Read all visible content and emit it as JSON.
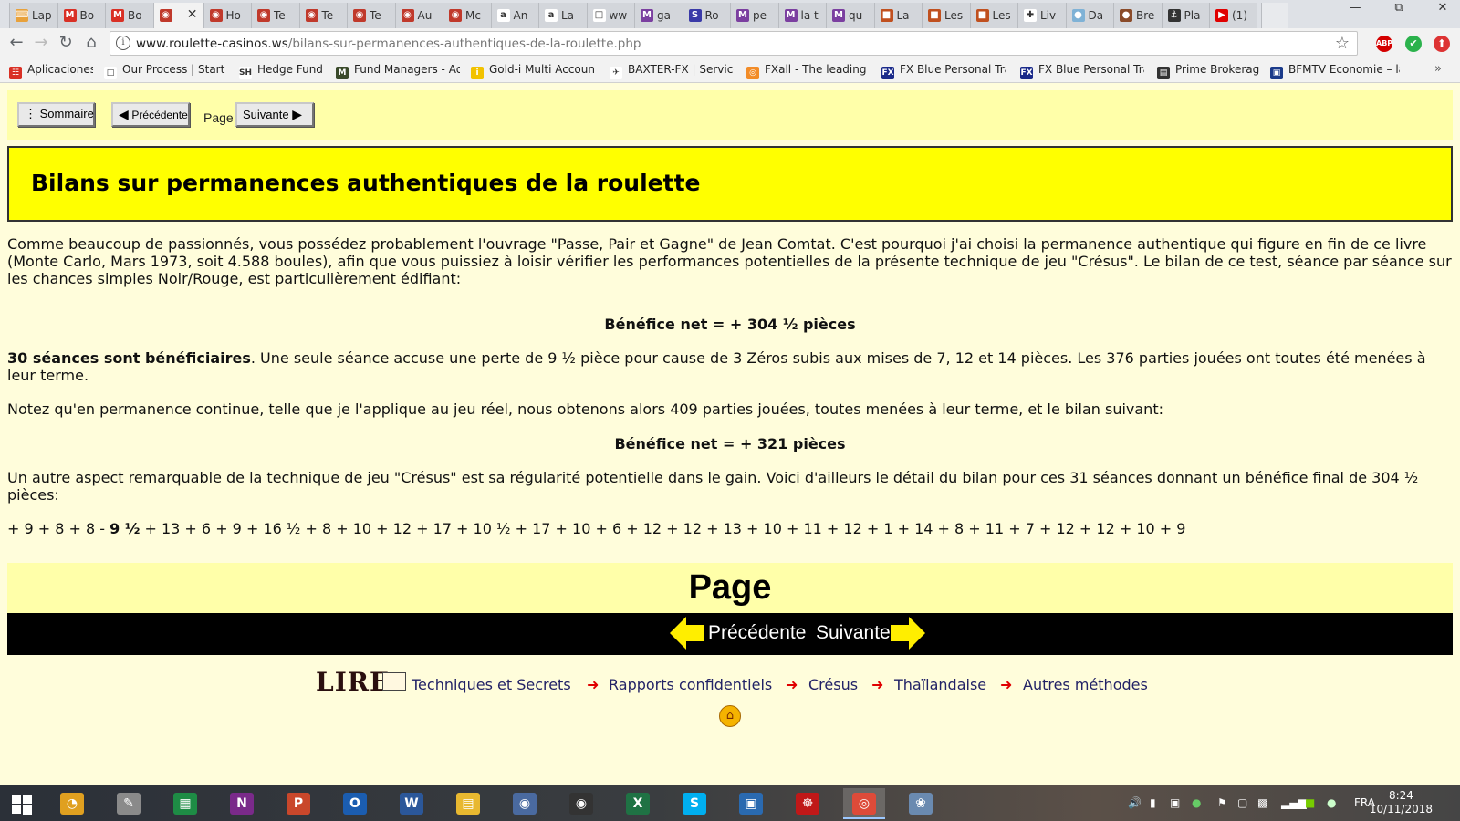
{
  "browser": {
    "tabs": [
      {
        "label": "Lap",
        "color": "#e8a13a",
        "glyph": "⌨"
      },
      {
        "label": "Bo",
        "color": "#d93025",
        "glyph": "M"
      },
      {
        "label": "Bo",
        "color": "#d93025",
        "glyph": "M"
      },
      {
        "label": "",
        "color": "#c0392b",
        "glyph": "◉",
        "active": true
      },
      {
        "label": "Ho",
        "color": "#c0392b",
        "glyph": "◉"
      },
      {
        "label": "Te",
        "color": "#c0392b",
        "glyph": "◉"
      },
      {
        "label": "Te",
        "color": "#c0392b",
        "glyph": "◉"
      },
      {
        "label": "Te",
        "color": "#c0392b",
        "glyph": "◉"
      },
      {
        "label": "Au",
        "color": "#c0392b",
        "glyph": "◉"
      },
      {
        "label": "Mc",
        "color": "#c0392b",
        "glyph": "◉"
      },
      {
        "label": "An",
        "color": "#ffffff",
        "glyph": "a"
      },
      {
        "label": "La",
        "color": "#ffffff",
        "glyph": "a"
      },
      {
        "label": "ww",
        "color": "#ffffff",
        "glyph": "□"
      },
      {
        "label": "ga",
        "color": "#7b3fa0",
        "glyph": "M"
      },
      {
        "label": "Ro",
        "color": "#3a3aa8",
        "glyph": "S"
      },
      {
        "label": "pe",
        "color": "#7b3fa0",
        "glyph": "M"
      },
      {
        "label": "la t",
        "color": "#7b3fa0",
        "glyph": "M"
      },
      {
        "label": "qu",
        "color": "#7b3fa0",
        "glyph": "M"
      },
      {
        "label": "La",
        "color": "#c0501f",
        "glyph": "■"
      },
      {
        "label": "Les",
        "color": "#c0501f",
        "glyph": "■"
      },
      {
        "label": "Les",
        "color": "#c0501f",
        "glyph": "■"
      },
      {
        "label": "Liv",
        "color": "#ffffff",
        "glyph": "✚"
      },
      {
        "label": "Da",
        "color": "#7fb2d6",
        "glyph": "●"
      },
      {
        "label": "Bre",
        "color": "#8a4b2a",
        "glyph": "●"
      },
      {
        "label": "Pla",
        "color": "#333333",
        "glyph": "⚓"
      },
      {
        "label": "(1)",
        "color": "#e00000",
        "glyph": "▶"
      }
    ],
    "url_domain": "www.roulette-casinos.ws",
    "url_path": "/bilans-sur-permanences-authentiques-de-la-roulette.php",
    "extensions": [
      "ABP",
      "✔",
      "⬆"
    ]
  },
  "bookmarks": [
    {
      "label": "Aplicaciones",
      "icon": "☷",
      "color": "#d93025"
    },
    {
      "label": "Our Process | Start a",
      "icon": "□",
      "color": "#ffffff"
    },
    {
      "label": "Hedge Funds",
      "icon": "SH",
      "color": "#ffffff"
    },
    {
      "label": "Fund Managers - Adv",
      "icon": "M",
      "color": "#3a4a2a"
    },
    {
      "label": "Gold-i Multi Account",
      "icon": "i",
      "color": "#f2c200"
    },
    {
      "label": "BAXTER-FX | Services",
      "icon": "✈",
      "color": "#ffffff"
    },
    {
      "label": "FXall - The leading in",
      "icon": "◎",
      "color": "#f28c28"
    },
    {
      "label": "FX Blue Personal Trac",
      "icon": "FX",
      "color": "#1a2a8a"
    },
    {
      "label": "FX Blue Personal Trac",
      "icon": "FX",
      "color": "#1a2a8a"
    },
    {
      "label": "Prime Brokerage",
      "icon": "▤",
      "color": "#333333"
    },
    {
      "label": "BFMTV Economie – la",
      "icon": "▣",
      "color": "#1a3a8a"
    }
  ],
  "page": {
    "nav": {
      "sommaire": "Sommaire",
      "precedente": "Précédente",
      "page_label": "Page",
      "suivante": "Suivante"
    },
    "title": "Bilans sur permanences authentiques de la roulette",
    "intro": "Comme beaucoup de passionnés, vous possédez probablement l'ouvrage \"Passe, Pair et Gagne\" de Jean Comtat. C'est pourquoi j'ai choisi la permanence authentique qui figure en fin de ce livre (Monte Carlo, Mars 1973, soit 4.588 boules), afin que vous puissiez à loisir vérifier les performances potentielles de la présente technique de jeu \"Crésus\". Le bilan de ce test, séance par séance sur les chances simples Noir/Rouge, est particulièrement édifiant:",
    "benefit1": "Bénéfice net = + 304 ½ pièces",
    "seances_bold": "30 séances sont bénéficiaires",
    "seances_rest": ". Une seule séance accuse une perte de 9 ½ pièce pour cause de 3 Zéros subis aux mises de 7, 12 et 14 pièces. Les 376 parties jouées ont toutes été menées à leur terme.",
    "continuous": "Notez qu'en permanence continue, telle que je l'applique au jeu réel, nous obtenons alors 409 parties jouées, toutes menées à leur terme, et le bilan suivant:",
    "benefit2": "Bénéfice net = + 321 pièces",
    "regularity": "Un autre aspect remarquable de la technique de jeu \"Crésus\" est sa régularité potentielle dans le gain. Voici d'ailleurs le détail du bilan pour ces 31 séances donnant un bénéfice final de 304 ½ pièces:",
    "series_a": "+ 9 + 8 + 8 - ",
    "series_bold": "9 ½",
    "series_b": " + 13 + 6 + 9 + 16 ½ + 8 + 10 + 12 + 17 + 10 ½ + 17 + 10 + 6 + 12 + 12 + 13 + 10 + 11 + 12 + 1 + 14 + 8 + 11 + 7 + 12 + 12 + 10 + 9",
    "band_title": "Page",
    "bottom_prev": "Précédente",
    "bottom_next": "Suivante",
    "lire": "LIRE",
    "footer_links": [
      "Techniques et Secrets",
      "Rapports confidentiels",
      "Crésus",
      "Thaïlandaise",
      "Autres méthodes"
    ]
  },
  "taskbar": {
    "apps": [
      {
        "name": "chrome-canary",
        "color": "#e0a020",
        "glyph": "◔"
      },
      {
        "name": "notepad",
        "color": "#8a8a8a",
        "glyph": "✎"
      },
      {
        "name": "project",
        "color": "#1e8c45",
        "glyph": "▦"
      },
      {
        "name": "onenote",
        "color": "#7a2a8a",
        "glyph": "N"
      },
      {
        "name": "powerpoint",
        "color": "#c9472b",
        "glyph": "P"
      },
      {
        "name": "outlook",
        "color": "#1b5db0",
        "glyph": "O"
      },
      {
        "name": "word",
        "color": "#2b579a",
        "glyph": "W"
      },
      {
        "name": "explorer",
        "color": "#e8b830",
        "glyph": "▤"
      },
      {
        "name": "owl-app",
        "color": "#4a6aa0",
        "glyph": "◉"
      },
      {
        "name": "owl-dark",
        "color": "#333333",
        "glyph": "◉"
      },
      {
        "name": "excel",
        "color": "#1f7244",
        "glyph": "X"
      },
      {
        "name": "skype",
        "color": "#00aff0",
        "glyph": "S"
      },
      {
        "name": "network",
        "color": "#2a6ab0",
        "glyph": "▣"
      },
      {
        "name": "acrobat",
        "color": "#c01818",
        "glyph": "☸"
      },
      {
        "name": "chrome",
        "color": "#dd4b39",
        "glyph": "◎",
        "active": true
      },
      {
        "name": "paint",
        "color": "#6a8ab0",
        "glyph": "❀"
      }
    ],
    "lang": "FRA",
    "time": "8:24",
    "date": "10/11/2018"
  }
}
